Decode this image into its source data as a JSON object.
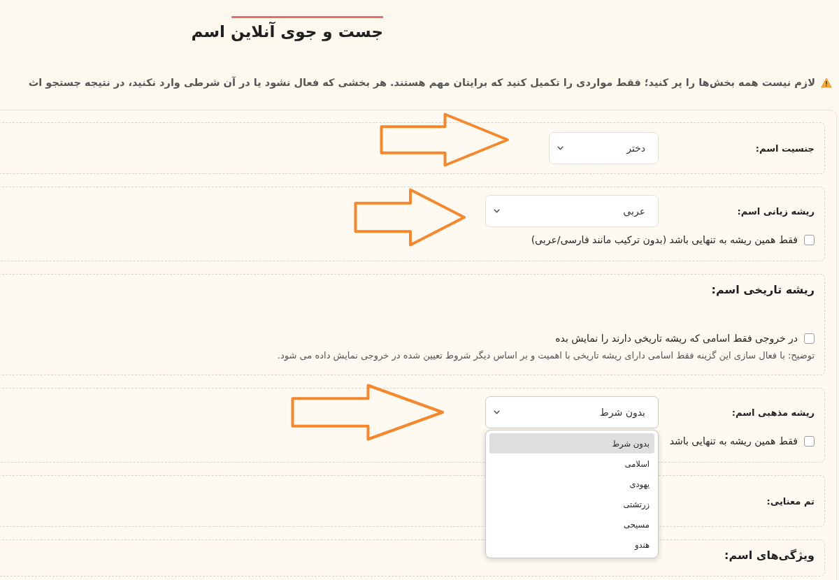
{
  "page_title": "جست و جوی آنلاین اسم",
  "notice": "لازم نیست همه بخش‌ها را پر کنید؛ فقط مواردی را تکمیل کنید که برایتان مهم هستند. هر بخشی که فعال نشود یا در آن شرطی وارد نکنید، در نتیجه جستجو اث",
  "sections": [
    {
      "kind": "field",
      "label": "جنسیت اسم:",
      "arrow": true,
      "select": {
        "value": "دختر",
        "expanded": false
      }
    },
    {
      "kind": "field",
      "label": "ریشه زبانی اسم:",
      "arrow": true,
      "select": {
        "value": "عربی",
        "expanded": false
      },
      "checkbox": {
        "label": "فقط همین ریشه به تنهایی باشد (بدون ترکیب مانند فارسی/عربی)",
        "checked": false
      }
    },
    {
      "kind": "group",
      "label": "ریشه تاریخی اسم:",
      "arrow": false,
      "checkbox": {
        "label": "در خروجی فقط اسامی که ریشه تاریخی دارند را نمایش بده",
        "checked": false
      },
      "description": "توضیح: با فعال سازی این گزینه فقط اسامی دارای ریشه تاریخی با اهمیت و بر اساس دیگر شروط تعیین شده در خروجی نمایش داده می شود."
    },
    {
      "kind": "field",
      "label": "ریشه مذهبی اسم:",
      "arrow": true,
      "select": {
        "value": "بدون شرط",
        "expanded": true,
        "options": [
          {
            "label": "بدون شرط",
            "selected": true
          },
          {
            "label": "اسلامی",
            "selected": false
          },
          {
            "label": "یهودی",
            "selected": false
          },
          {
            "label": "زرتشتی",
            "selected": false
          },
          {
            "label": "مسیحی",
            "selected": false
          },
          {
            "label": "هندو",
            "selected": false
          }
        ]
      },
      "checkbox": {
        "label": "فقط همین ریشه به تنهایی باشد",
        "checked": false
      }
    },
    {
      "kind": "field",
      "label": "تم معنایی:",
      "arrow": false
    },
    {
      "kind": "group",
      "label": "ویژگی‌های اسم:",
      "arrow": false
    }
  ]
}
